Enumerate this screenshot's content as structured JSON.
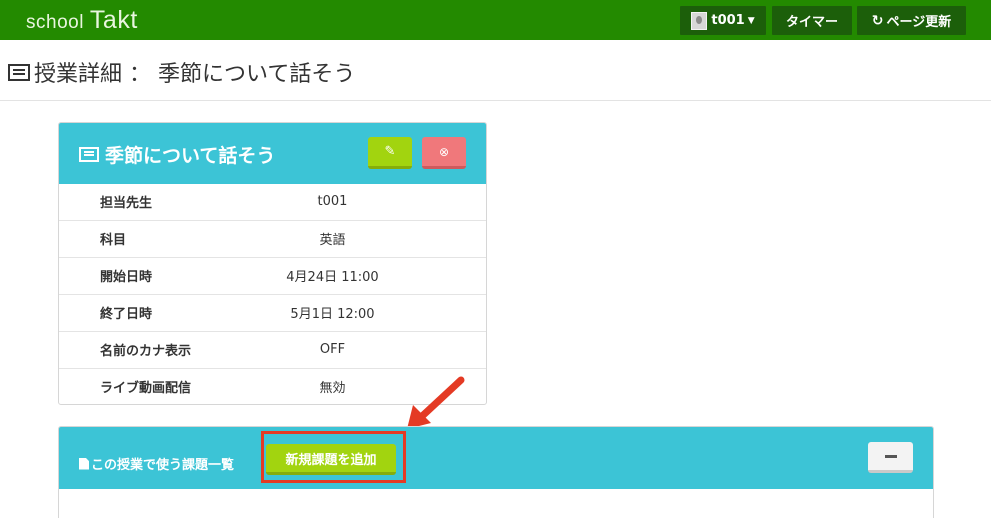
{
  "navbar": {
    "brand_a": "school",
    "brand_b": "Takt",
    "user_label": "t001",
    "timer_label": "タイマー",
    "reload_label": "ページ更新"
  },
  "page": {
    "title": "授業詳細 ： 季節について話そう"
  },
  "lesson": {
    "title": "季節について話そう",
    "rows": [
      {
        "key": "担当先生",
        "value": "t001"
      },
      {
        "key": "科目",
        "value": "英語"
      },
      {
        "key": "開始日時",
        "value": "4月24日 11:00"
      },
      {
        "key": "終了日時",
        "value": "5月1日 12:00"
      },
      {
        "key": "名前のカナ表示",
        "value": "OFF"
      },
      {
        "key": "ライブ動画配信",
        "value": "無効"
      }
    ]
  },
  "assignments": {
    "title": "この授業で使う課題一覧",
    "add_label": "新規課題を追加"
  },
  "icons": {
    "list": "list-icon",
    "edit": "edit-icon",
    "delete": "delete-icon",
    "reload": "reload-icon",
    "minimize": "minus-icon",
    "file": "file-icon",
    "arrow": "annotation-arrow"
  },
  "colors": {
    "navbar": "#238a00",
    "panel_header": "#3cc4d6",
    "accent_green": "#a2d40f",
    "danger": "#f0787b",
    "highlight": "#e43a24"
  }
}
